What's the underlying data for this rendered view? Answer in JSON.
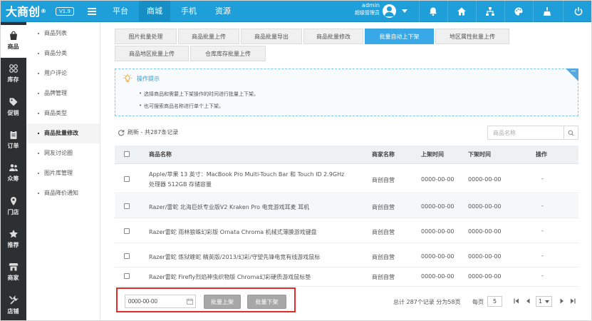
{
  "app": {
    "logo": "大商创",
    "logo_mark": "®",
    "version": "V1.9"
  },
  "topnav": [
    {
      "label": "平台",
      "active": false
    },
    {
      "label": "商城",
      "active": true
    },
    {
      "label": "手机",
      "active": false
    },
    {
      "label": "资源",
      "active": false
    }
  ],
  "user": {
    "name": "admin",
    "role": "超级管理员"
  },
  "topicons": [
    "bell-icon",
    "home-icon",
    "sitemap-icon",
    "palette-icon",
    "broom-icon",
    "power-icon"
  ],
  "iconbar": [
    {
      "label": "商品",
      "icon": "bag-icon",
      "active": true
    },
    {
      "label": "库存",
      "icon": "boxes-icon",
      "active": false
    },
    {
      "label": "促销",
      "icon": "tag-icon",
      "active": false
    },
    {
      "label": "订单",
      "icon": "clipboard-icon",
      "active": false
    },
    {
      "label": "众筹",
      "icon": "users-icon",
      "active": false
    },
    {
      "label": "门店",
      "icon": "map-marker-icon",
      "active": false
    },
    {
      "label": "推荐",
      "icon": "star-icon",
      "active": false
    },
    {
      "label": "商家",
      "icon": "store-icon",
      "active": false
    },
    {
      "label": "店铺",
      "icon": "shop-tools-icon",
      "active": false
    }
  ],
  "subnav": [
    {
      "label": "商品列表",
      "active": false
    },
    {
      "label": "商品分类",
      "active": false
    },
    {
      "label": "用户评论",
      "active": false
    },
    {
      "label": "品牌管理",
      "active": false
    },
    {
      "label": "商品类型",
      "active": false
    },
    {
      "label": "商品批量修改",
      "active": true
    },
    {
      "label": "网友讨论圈",
      "active": false
    },
    {
      "label": "图片库管理",
      "active": false
    },
    {
      "label": "商品降价通知",
      "active": false
    }
  ],
  "tabs": [
    {
      "label": "图片批量处理",
      "active": false
    },
    {
      "label": "商品批量上传",
      "active": false
    },
    {
      "label": "商品批量导出",
      "active": false
    },
    {
      "label": "商品批量修改",
      "active": false
    },
    {
      "label": "批量自动上下架",
      "active": true
    },
    {
      "label": "地区属性批量上传",
      "active": false
    },
    {
      "label": "商品地区批量上传",
      "active": false
    },
    {
      "label": "仓库库存批量上传",
      "active": false
    }
  ],
  "tips": {
    "title": "操作提示",
    "lines": [
      "选择商品和需要上下架操作的时间进行批量上下架。",
      "也可搜索商品名称进行单个上下架。"
    ]
  },
  "toolbar": {
    "refresh": "刷新 - 共287条记录",
    "search_placeholder": "商品名称"
  },
  "table": {
    "headers": [
      "商品名称",
      "商家名称",
      "上架时间",
      "下架时间",
      "操作"
    ],
    "rows": [
      {
        "name_line1": "Apple/苹果 13 英寸：MacBook Pro Multi-Touch Bar 和 Touch ID 2.9GHz",
        "name_line2": "处理器 512GB 存储容量",
        "seller": "商创自营",
        "on_time": "0000-00-00",
        "off_time": "0000-00-00",
        "action": "-"
      },
      {
        "name_line1": "Razer/雷蛇 北海巨妖专业版V2 Kraken Pro 电竞游戏耳麦 耳机",
        "name_line2": "",
        "seller": "商创自营",
        "on_time": "0000-00-00",
        "off_time": "0000-00-00",
        "action": "-"
      },
      {
        "name_line1": "Razer雷蛇 雨林狼蛛幻彩版 Ornata Chroma 机械式薄膜游戏键盘",
        "name_line2": "",
        "seller": "商创自营",
        "on_time": "0000-00-00",
        "off_time": "0000-00-00",
        "action": "-"
      },
      {
        "name_line1": "Razer雷蛇 炼狱蝰蛇 精英版/2013/幻彩/守望先锋电竞有线游戏鼠标",
        "name_line2": "",
        "seller": "商创自营",
        "on_time": "0000-00-00",
        "off_time": "0000-00-00",
        "action": "-"
      },
      {
        "name_line1": "Razer雷蛇 Firefly烈焰神虫织物版 Chroma幻彩硬质游戏鼠标垫",
        "name_line2": "",
        "seller": "商创自营",
        "on_time": "0000-00-00",
        "off_time": "0000-00-00",
        "action": "-"
      }
    ]
  },
  "footer": {
    "date_value": "0000-00-00",
    "btn_on": "批量上架",
    "btn_off": "批量下架",
    "total": "总计 287个记录 分为58页",
    "per_page_label": "每页",
    "per_page": "5",
    "page": "1"
  },
  "colors": {
    "topbar": "#1f9fd9",
    "tab_active": "#39a8e6",
    "highlight_box": "#e22c2c",
    "sidebar_dark": "#2d3033"
  }
}
